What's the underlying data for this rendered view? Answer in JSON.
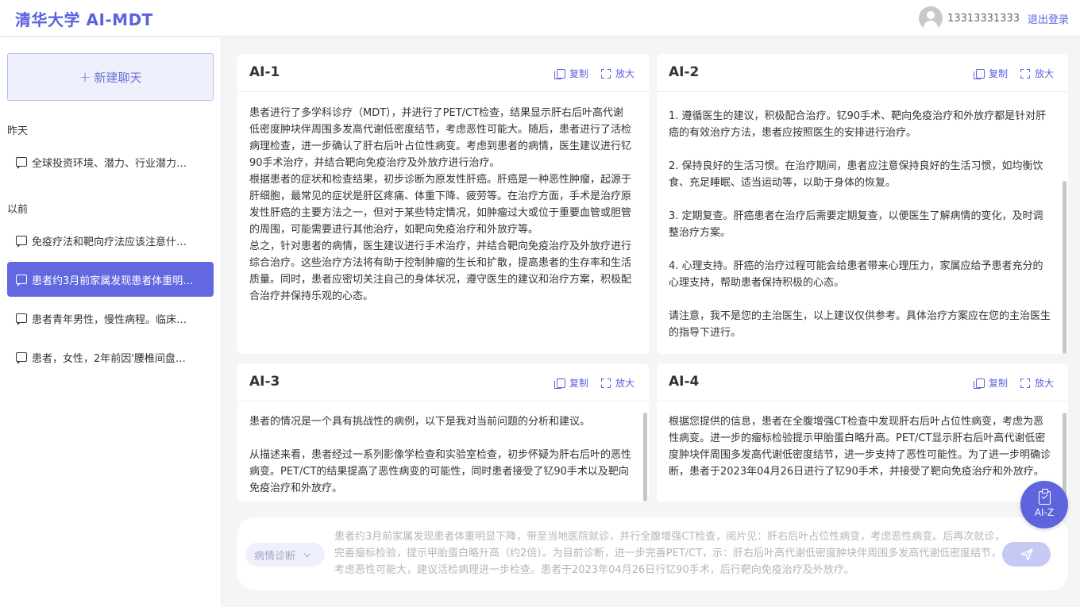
{
  "header": {
    "brand": "清华大学 AI-MDT",
    "phone": "13313331333",
    "logout": "退出登录"
  },
  "sidebar": {
    "new_chat": "新建聊天",
    "section_yesterday": "昨天",
    "section_earlier": "以前",
    "items": [
      {
        "label": "全球投资环境、潜力、行业潜力…"
      },
      {
        "label": "免疫疗法和靶向疗法应该注意什…"
      },
      {
        "label": "患者约3月前家属发现患者体重明…"
      },
      {
        "label": "患者青年男性，慢性病程。临床…"
      },
      {
        "label": "患者，女性，2年前因'腰椎间盘…"
      }
    ]
  },
  "actions": {
    "copy": "复制",
    "expand": "放大"
  },
  "cards": [
    {
      "title": "AI-1",
      "body": "患者进行了多学科诊疗（MDT），并进行了PET/CT检查，结果显示肝右后叶高代谢低密度肿块伴周围多发高代谢低密度结节，考虑恶性可能大。随后，患者进行了活检病理检查，进一步确认了肝右后叶占位性病变。考虑到患者的病情，医生建议进行钇90手术治疗，并结合靶向免疫治疗及外放疗进行治疗。\n根据患者的症状和检查结果，初步诊断为原发性肝癌。肝癌是一种恶性肿瘤，起源于肝细胞，最常见的症状是肝区疼痛、体重下降、疲劳等。在治疗方面，手术是治疗原发性肝癌的主要方法之一，但对于某些特定情况，如肿瘤过大或位于重要血管或胆管的周围，可能需要进行其他治疗，如靶向免疫治疗和外放疗等。\n总之，针对患者的病情，医生建议进行手术治疗，并结合靶向免疫治疗及外放疗进行综合治疗。这些治疗方法将有助于控制肿瘤的生长和扩散，提高患者的生存率和生活质量。同时，患者应密切关注自己的身体状况，遵守医生的建议和治疗方案，积极配合治疗并保持乐观的心态。"
    },
    {
      "title": "AI-2",
      "body": "1. 遵循医生的建议，积极配合治疗。钇90手术、靶向免疫治疗和外放疗都是针对肝癌的有效治疗方法，患者应按照医生的安排进行治疗。\n\n2. 保持良好的生活习惯。在治疗期间，患者应注意保持良好的生活习惯，如均衡饮食、充足睡眠、适当运动等，以助于身体的恢复。\n\n3. 定期复查。肝癌患者在治疗后需要定期复查，以便医生了解病情的变化，及时调整治疗方案。\n\n4. 心理支持。肝癌的治疗过程可能会给患者带来心理压力，家属应给予患者充分的心理支持，帮助患者保持积极的心态。\n\n请注意，我不是您的主治医生，以上建议仅供参考。具体治疗方案应在您的主治医生的指导下进行。"
    },
    {
      "title": "AI-3",
      "body": "患者的情况是一个具有挑战性的病例，以下是我对当前问题的分析和建议。\n\n从描述来看，患者经过一系列影像学检查和实验室检查，初步怀疑为肝右后叶的恶性病变。PET/CT的结果提高了恶性病变的可能性，同时患者接受了钇90手术以及靶向免疫治疗和外放疗。"
    },
    {
      "title": "AI-4",
      "body": "根据您提供的信息，患者在全腹增强CT检查中发现肝右后叶占位性病变，考虑为恶性病变。进一步的瘤标检验提示甲胎蛋白略升高。PET/CT显示肝右后叶高代谢低密度肿块伴周围多发高代谢低密度结节，进一步支持了恶性可能性。为了进一步明确诊断，患者于2023年04月26日进行了钇90手术，并接受了靶向免疫治疗和外放疗。"
    }
  ],
  "input": {
    "mode": "病情诊断",
    "text": "患者约3月前家属发现患者体重明显下降，带至当地医院就诊，并行全腹增强CT检查，阅片见：肝右后叶占位性病变，考虑恶性病变。后再次就诊，完善瘤标检验，提示甲胎蛋白略升高（约2倍）。为目前诊断，进一步完善PET/CT，示：肝右后叶高代谢低密度肿块伴周围多发高代谢低密度结节，考虑恶性可能大，建议活检病理进一步检查。患者于2023年04月26日行钇90手术，后行靶向免疫治疗及外放疗。"
  },
  "float_button": {
    "label": "AI-Z"
  },
  "colors": {
    "accent": "#5b62e0",
    "active_item": "#6268e0",
    "send_button": "#c5c9f4"
  }
}
